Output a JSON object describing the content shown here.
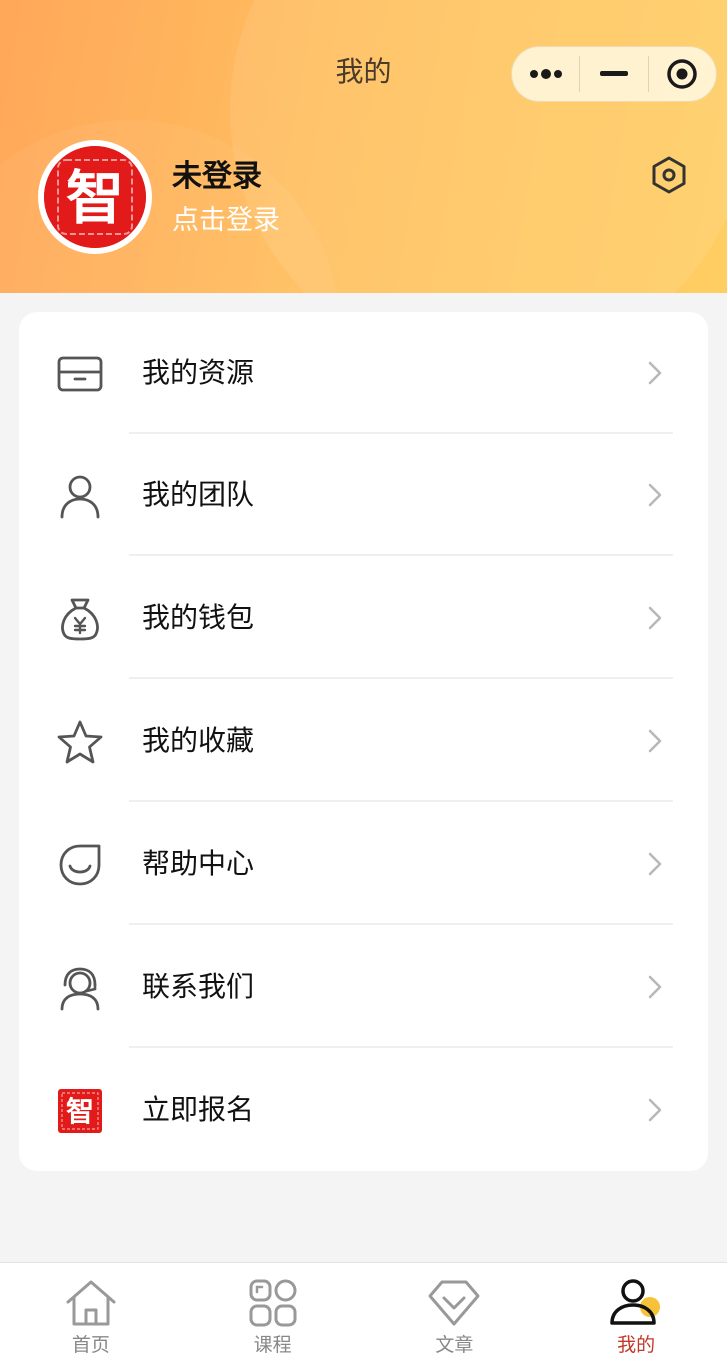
{
  "nav": {
    "title": "我的"
  },
  "capsule": {
    "more_icon": "more-dots-icon",
    "minimize_icon": "minimize-icon",
    "close_icon": "target-icon"
  },
  "profile": {
    "avatar_char": "智",
    "name": "未登录",
    "login_text": "点击登录",
    "settings_icon": "hexagon-settings-icon"
  },
  "menu": {
    "items": [
      {
        "label": "我的资源",
        "icon": "card-icon"
      },
      {
        "label": "我的团队",
        "icon": "person-icon"
      },
      {
        "label": "我的钱包",
        "icon": "money-bag-icon"
      },
      {
        "label": "我的收藏",
        "icon": "star-icon"
      },
      {
        "label": "帮助中心",
        "icon": "smile-icon"
      },
      {
        "label": "联系我们",
        "icon": "customer-service-icon"
      },
      {
        "label": "立即报名",
        "icon": "zhi-logo-icon"
      }
    ]
  },
  "tabbar": {
    "tabs": [
      {
        "label": "首页",
        "icon": "home-icon"
      },
      {
        "label": "课程",
        "icon": "grid-icon"
      },
      {
        "label": "文章",
        "icon": "diamond-icon"
      },
      {
        "label": "我的",
        "icon": "user-icon",
        "active": true
      }
    ]
  },
  "colors": {
    "header_start": "#ffa75a",
    "header_end": "#ffce62",
    "active_tab": "#c0392b",
    "logo_red": "#e21a1a"
  }
}
